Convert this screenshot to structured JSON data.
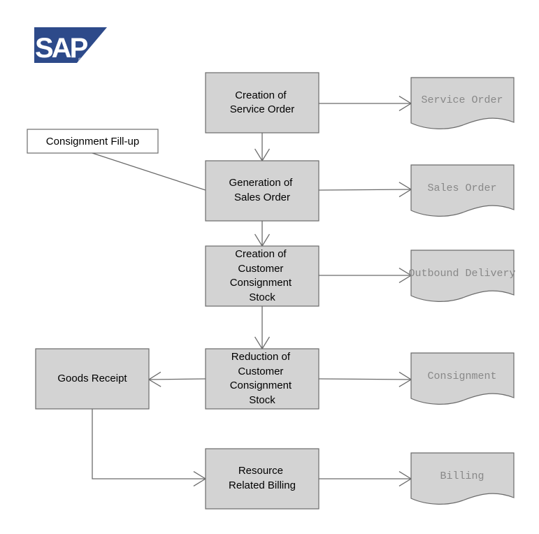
{
  "logo": {
    "text": "SAP",
    "registered_mark": "®",
    "color": "#2d4a8a"
  },
  "colors": {
    "process_fill": "#d3d3d3",
    "process_stroke": "#6b6b6b",
    "document_fill": "#d3d3d3",
    "document_text": "#888888",
    "connector": "#6b6b6b",
    "note_fill": "#ffffff"
  },
  "note": {
    "label": "Consignment Fill-up"
  },
  "processes": [
    {
      "id": "p1",
      "lines": [
        "Creation of",
        "Service Order"
      ]
    },
    {
      "id": "p2",
      "lines": [
        "Generation of",
        "Sales Order"
      ]
    },
    {
      "id": "p3",
      "lines": [
        "Creation of",
        "Customer",
        "Consignment",
        "Stock"
      ]
    },
    {
      "id": "p4",
      "lines": [
        "Reduction of",
        "Customer",
        "Consignment",
        "Stock"
      ]
    },
    {
      "id": "p5",
      "lines": [
        "Resource",
        "Related Billing"
      ]
    },
    {
      "id": "gr",
      "lines": [
        "Goods Receipt"
      ]
    }
  ],
  "documents": [
    {
      "id": "d1",
      "label": "Service Order"
    },
    {
      "id": "d2",
      "label": "Sales Order"
    },
    {
      "id": "d3",
      "label": "Outbound Delivery"
    },
    {
      "id": "d4",
      "label": "Consignment"
    },
    {
      "id": "d5",
      "label": "Billing"
    }
  ],
  "edges": [
    {
      "from": "p1",
      "to": "p2"
    },
    {
      "from": "p2",
      "to": "p3"
    },
    {
      "from": "p3",
      "to": "p4"
    },
    {
      "from": "p4",
      "to": "gr"
    },
    {
      "from": "gr",
      "to": "p5"
    },
    {
      "from": "p1",
      "to": "d1"
    },
    {
      "from": "p2",
      "to": "d2"
    },
    {
      "from": "p3",
      "to": "d3"
    },
    {
      "from": "p4",
      "to": "d4"
    },
    {
      "from": "p5",
      "to": "d5"
    },
    {
      "from": "note",
      "to": "p2",
      "arrow": false
    }
  ]
}
